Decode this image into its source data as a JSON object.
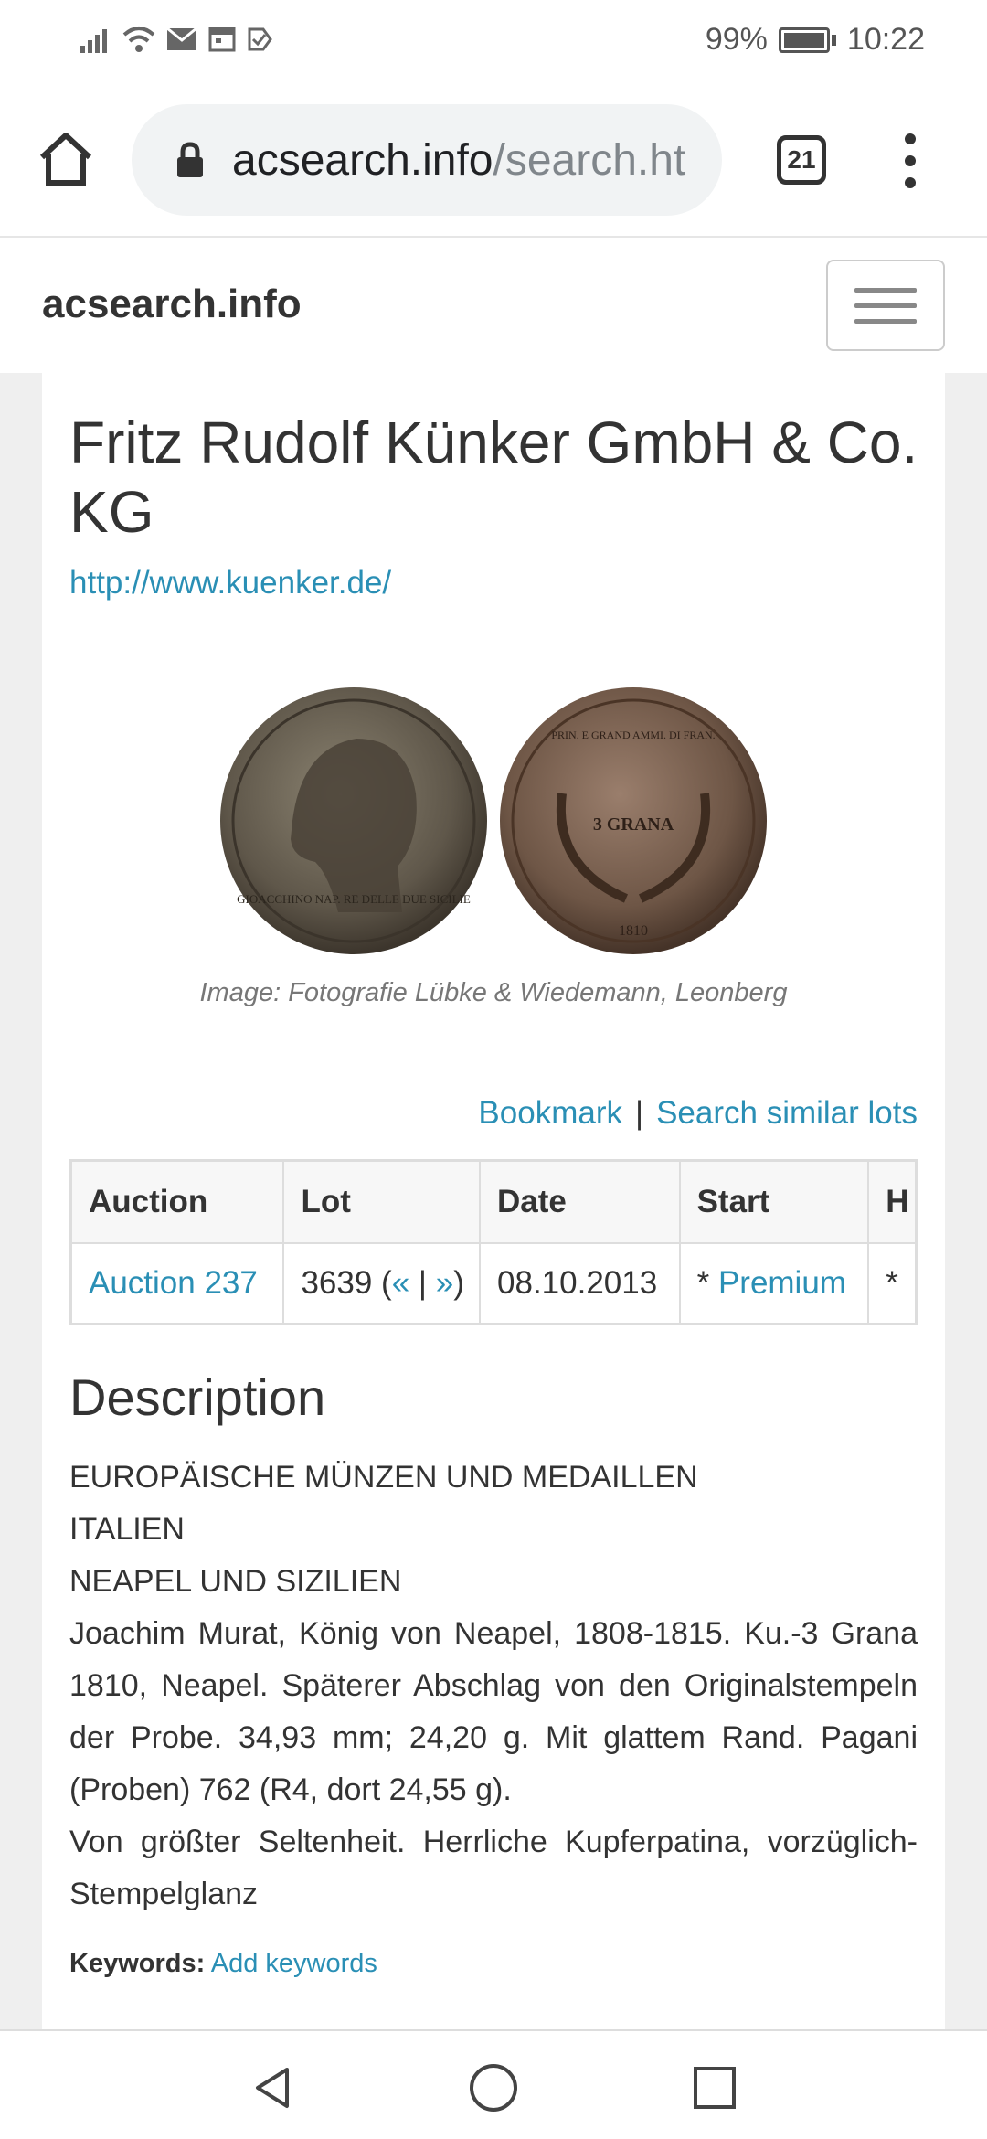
{
  "status_bar": {
    "battery_percent": "99%",
    "time": "10:22"
  },
  "browser": {
    "url_host": "acsearch.info",
    "url_path": "/search.ht",
    "tab_count": "21"
  },
  "site": {
    "brand": "acsearch.info"
  },
  "auction_house": {
    "name": "Fritz Rudolf Künker GmbH & Co. KG",
    "url": "http://www.kuenker.de/"
  },
  "image": {
    "caption": "Image: Fotografie Lübke & Wiedemann, Leonberg",
    "coin_reverse_text": "3 GRANA",
    "coin_obverse_legend": "GIOACCHINO NAP. RE DELLE DUE SICILIE",
    "coin_reverse_legend": "PRIN. E GRAND AMMI. DI FRAN.",
    "coin_year": "1810"
  },
  "actions": {
    "bookmark": "Bookmark",
    "separator": "|",
    "similar": "Search similar lots"
  },
  "table": {
    "headers": [
      "Auction",
      "Lot",
      "Date",
      "Start",
      "H"
    ],
    "row": {
      "auction": "Auction 237",
      "lot_number": "3639 (",
      "lot_prev": "«",
      "lot_sep": " | ",
      "lot_next": "»",
      "lot_close": ")",
      "date": "08.10.2013",
      "start_prefix": "* ",
      "start_link": "Premium",
      "h": "*"
    }
  },
  "description": {
    "title": "Description",
    "category_1": "EUROPÄISCHE MÜNZEN UND MEDAILLEN",
    "category_2": "ITALIEN",
    "category_3": "NEAPEL UND SIZILIEN",
    "text": "Joachim Murat, König von Neapel, 1808-1815. Ku.-3 Grana 1810, Neapel. Späterer Abschlag von den Originalstempeln der Probe. 34,93 mm; 24,20 g. Mit glattem Rand. Pagani (Proben) 762 (R4, dort 24,55 g).",
    "rarity": "Von größter Seltenheit. Herrliche Kupferpatina, vorzüglich-Stempelglanz"
  },
  "keywords": {
    "label": "Keywords:",
    "add": "Add keywords"
  },
  "icons": {
    "home": "home-icon",
    "lock": "lock-icon",
    "menu": "more-vert-icon",
    "back": "back-icon",
    "home_nav": "circle-home-icon",
    "recents": "square-recents-icon"
  },
  "colors": {
    "link": "#2a8fb5"
  }
}
